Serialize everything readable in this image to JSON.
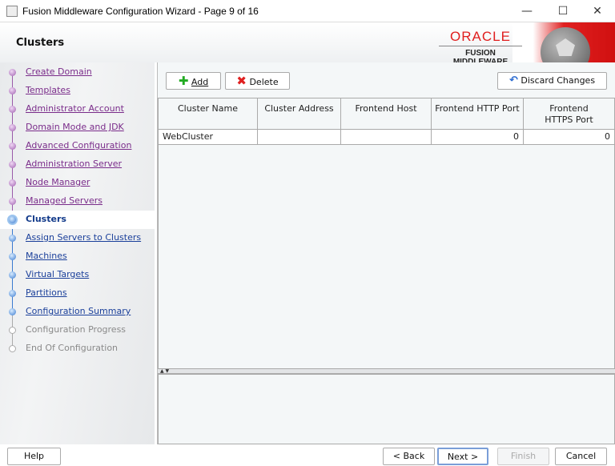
{
  "window": {
    "title": "Fusion Middleware Configuration Wizard - Page 9 of 16",
    "minimize": "—",
    "maximize": "☐",
    "close": "✕"
  },
  "header": {
    "page_title": "Clusters",
    "brand": "ORACLE",
    "brand_sub": "FUSION MIDDLEWARE"
  },
  "nav": [
    {
      "label": "Create Domain",
      "state": "done"
    },
    {
      "label": "Templates",
      "state": "done"
    },
    {
      "label": "Administrator Account",
      "state": "done"
    },
    {
      "label": "Domain Mode and JDK",
      "state": "done"
    },
    {
      "label": "Advanced Configuration",
      "state": "done"
    },
    {
      "label": "Administration Server",
      "state": "done"
    },
    {
      "label": "Node Manager",
      "state": "done"
    },
    {
      "label": "Managed Servers",
      "state": "done"
    },
    {
      "label": "Clusters",
      "state": "cur"
    },
    {
      "label": "Assign Servers to Clusters",
      "state": "todo"
    },
    {
      "label": "Machines",
      "state": "todo"
    },
    {
      "label": "Virtual Targets",
      "state": "todo"
    },
    {
      "label": "Partitions",
      "state": "todo"
    },
    {
      "label": "Configuration Summary",
      "state": "todo"
    },
    {
      "label": "Configuration Progress",
      "state": "off"
    },
    {
      "label": "End Of Configuration",
      "state": "off"
    }
  ],
  "toolbar": {
    "add": "Add",
    "delete": "Delete",
    "discard": "Discard Changes"
  },
  "table": {
    "columns": [
      "Cluster Name",
      "Cluster Address",
      "Frontend Host",
      "Frontend HTTP Port",
      "Frontend HTTPS Port"
    ],
    "rows": [
      [
        "WebCluster",
        "",
        "",
        "0",
        "0"
      ]
    ]
  },
  "footer": {
    "help": "Help",
    "back": "< Back",
    "next": "Next >",
    "finish": "Finish",
    "cancel": "Cancel"
  }
}
